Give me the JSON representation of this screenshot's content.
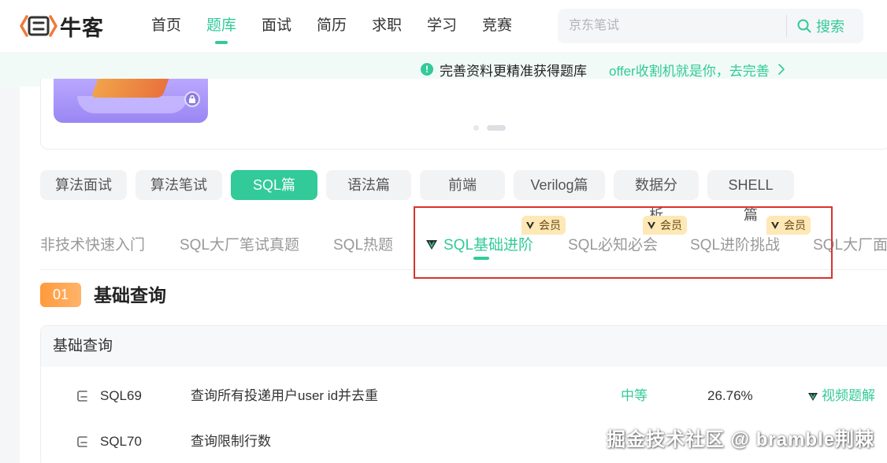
{
  "brand": {
    "logo_text": "牛客"
  },
  "nav": {
    "items": [
      {
        "label": "首页"
      },
      {
        "label": "题库"
      },
      {
        "label": "面试"
      },
      {
        "label": "简历"
      },
      {
        "label": "求职"
      },
      {
        "label": "学习"
      },
      {
        "label": "竞赛"
      }
    ],
    "active_index": 1
  },
  "search": {
    "placeholder": "京东笔试",
    "button_label": "搜索"
  },
  "notice": {
    "text": "完善资料更精准获得题库",
    "link": "offer收割机就是你，去完善"
  },
  "categories": {
    "items": [
      "算法面试",
      "算法笔试",
      "SQL篇",
      "语法篇",
      "前端",
      "Verilog篇",
      "数据分析",
      "SHELL篇"
    ],
    "active_index": 2
  },
  "subtabs": {
    "items": [
      {
        "label": "非技术快速入门",
        "vip": false
      },
      {
        "label": "SQL大厂笔试真题",
        "vip": false
      },
      {
        "label": "SQL热题",
        "vip": false
      },
      {
        "label": "SQL基础进阶",
        "vip": true
      },
      {
        "label": "SQL必知必会",
        "vip": true
      },
      {
        "label": "SQL进阶挑战",
        "vip": true
      },
      {
        "label": "SQL大厂面",
        "vip": false
      }
    ],
    "active_index": 3,
    "vip_badge_label": "会员"
  },
  "section": {
    "number": "01",
    "title": "基础查询"
  },
  "table": {
    "header": "基础查询",
    "rows": [
      {
        "id": "SQL69",
        "title": "查询所有投递用户user id并去重",
        "difficulty": "中等",
        "pass_rate": "26.76%",
        "video": "视频题解"
      },
      {
        "id": "SQL70",
        "title": "查询限制行数",
        "difficulty": "",
        "pass_rate": "",
        "video": ""
      }
    ]
  },
  "watermark": "掘金技术社区 @ bramble荆棘",
  "colors": {
    "accent": "#32ca99",
    "vip_badge": "#fde8b6",
    "section_badge": "#ff9a3c",
    "highlight_frame": "#d9332e"
  }
}
